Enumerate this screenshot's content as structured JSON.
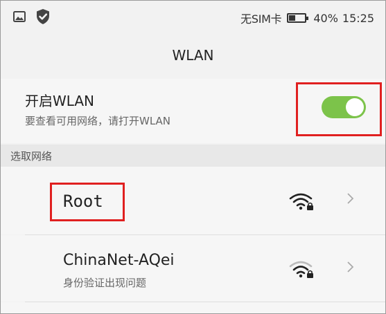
{
  "status_bar": {
    "left_icons": [
      "image-notification-icon",
      "shield-check-icon"
    ],
    "carrier": "无SIM卡",
    "battery_percent": "40%",
    "battery_level": 0.4,
    "time": "15:25"
  },
  "header": {
    "title": "WLAN"
  },
  "wlan_toggle": {
    "title": "开启WLAN",
    "subtitle": "要查看可用网络，请打开WLAN",
    "enabled": true,
    "accent_color": "#7cc34a"
  },
  "networks_section": {
    "header": "选取网络",
    "networks": [
      {
        "name": "Root",
        "status": "",
        "secured": true,
        "signal_icon": "wifi-lock-icon"
      },
      {
        "name": "ChinaNet-AQei",
        "status": "身份验证出现问题",
        "secured": true,
        "signal_icon": "wifi-lock-icon"
      }
    ]
  },
  "annotations": {
    "highlight_color": "#e02020"
  }
}
